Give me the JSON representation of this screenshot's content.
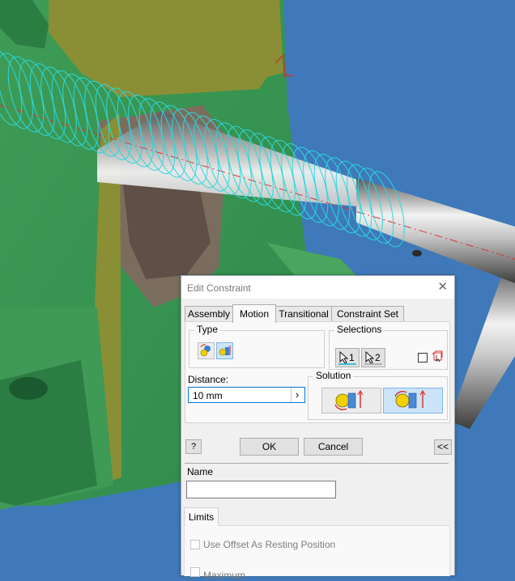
{
  "dialog": {
    "title": "Edit Constraint",
    "close_glyph": "✕",
    "tabs": [
      {
        "label": "Assembly",
        "active": false
      },
      {
        "label": "Motion",
        "active": true
      },
      {
        "label": "Transitional",
        "active": false
      },
      {
        "label": "Constraint Set",
        "active": false
      }
    ],
    "type": {
      "label": "Type",
      "options": [
        {
          "icon": "rotation-icon",
          "selected": false
        },
        {
          "icon": "rotation-translation-icon",
          "selected": true
        }
      ]
    },
    "selections": {
      "label": "Selections",
      "buttons": [
        {
          "label": "1",
          "icon": "cursor-arrow-icon",
          "underline_color": "#3dbfd9"
        },
        {
          "label": "2",
          "icon": "cursor-arrow-icon",
          "underline_color": "#b3b3b3"
        }
      ],
      "first_occurrence_checked": false,
      "first_occurrence_icon": "select-other-icon"
    },
    "distance": {
      "label": "Distance:",
      "value": "10 mm",
      "arrow_glyph": "›"
    },
    "solution": {
      "label": "Solution",
      "options": [
        {
          "icon": "forward-solution-icon",
          "selected": false
        },
        {
          "icon": "reverse-solution-icon",
          "selected": true
        }
      ]
    },
    "help_glyph": "?",
    "ok_label": "OK",
    "cancel_label": "Cancel",
    "collapse_label": "<<",
    "name": {
      "label": "Name",
      "value": ""
    },
    "limits": {
      "tab_label": "Limits",
      "use_offset_label": "Use Offset As Resting Position",
      "maximum_label": "Maximum"
    }
  },
  "colors": {
    "background": "#3f79b9",
    "part_green": "#4aa65e",
    "section_cut": "#8a8f35",
    "spring_cyan": "#29d8e0",
    "accent_red": "#e53935"
  }
}
